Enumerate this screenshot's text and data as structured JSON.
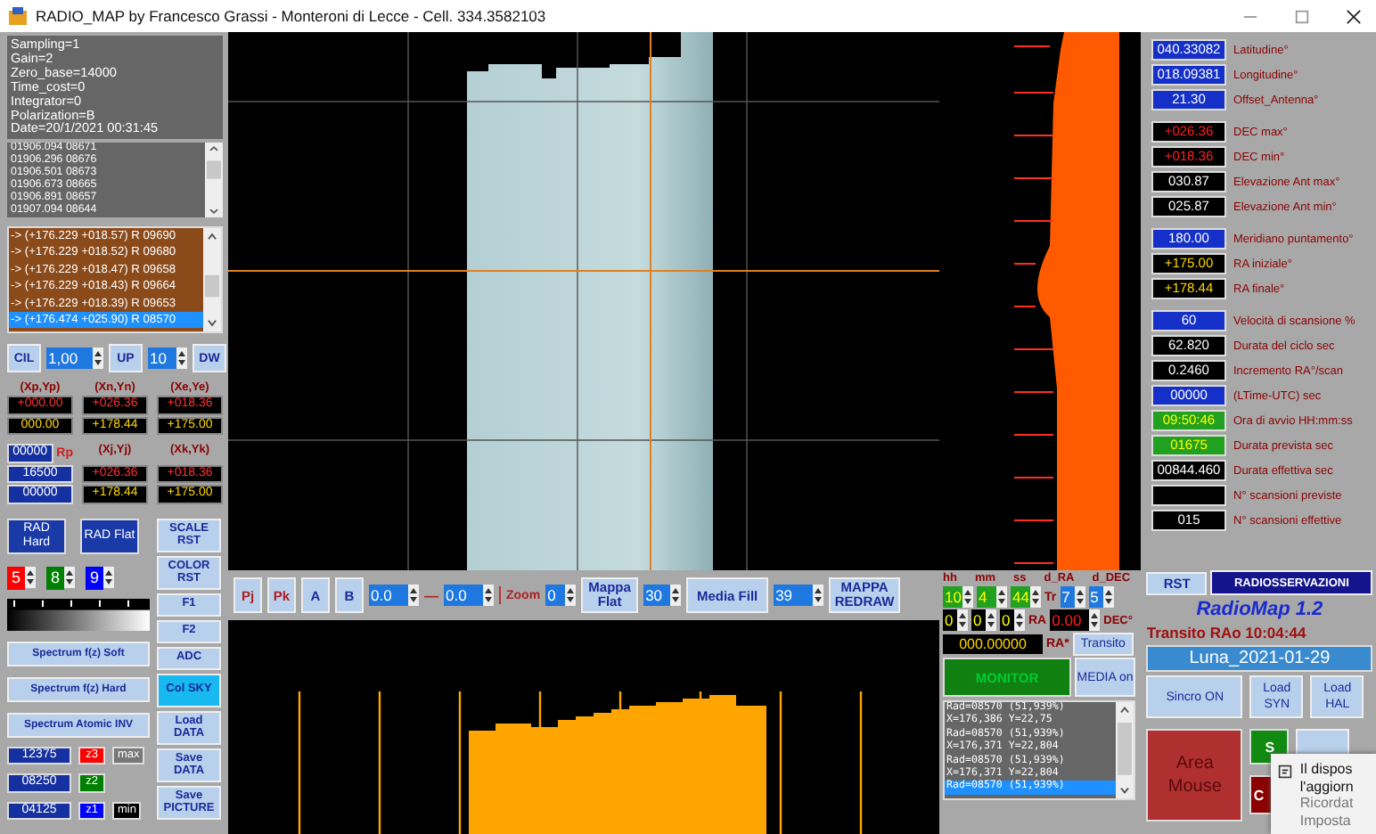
{
  "window": {
    "title": "RADIO_MAP by Francesco Grassi - Monteroni di Lecce - Cell. 334.3582103"
  },
  "info_lines": [
    "Sampling=1",
    "Gain=2",
    "Zero_base=14000",
    "Time_cost=0",
    "Integrator=0",
    "Polarization=B",
    "Date=20/1/2021 00:31:45"
  ],
  "sample_list": [
    "01906.094 08671",
    "01906.296 08676",
    "01906.501 08673",
    "01906.673 08665",
    "01906.891 08657",
    "01907.094 08644"
  ],
  "position_list": [
    {
      "text": "-> (+176.229 +018.57) R 09690",
      "selected": false
    },
    {
      "text": "-> (+176.229 +018.52) R 09680",
      "selected": false
    },
    {
      "text": "-> (+176.229 +018.47) R 09658",
      "selected": false
    },
    {
      "text": "-> (+176.229 +018.43) R 09664",
      "selected": false
    },
    {
      "text": "-> (+176.229 +018.39) R 09653",
      "selected": false
    },
    {
      "text": "-> (+176.474 +025.90) R 08570",
      "selected": true
    }
  ],
  "scan_controls": {
    "cil_button": "CIL",
    "step": "1,00",
    "up_button": "UP",
    "count": "10",
    "dw_button": "DW"
  },
  "coords_top": {
    "labels": [
      "(Xp,Yp)",
      "(Xn,Yn)",
      "(Xe,Ye)"
    ],
    "rows": [
      [
        "+000.00",
        "+026.36",
        "+018.36"
      ],
      [
        "000.00",
        "+178.44",
        "+175.00"
      ]
    ]
  },
  "rp": {
    "value": "00000",
    "label": "Rp"
  },
  "coords_bottom": {
    "labels": [
      "(Xj,Yj)",
      "(Xk,Yk)"
    ],
    "rows": [
      [
        "16500",
        "+026.36",
        "+018.36"
      ],
      [
        "00000",
        "+178.44",
        "+175.00"
      ]
    ]
  },
  "rad_buttons": [
    "RAD Hard",
    "RAD Flat"
  ],
  "color_spinners": [
    {
      "value": "5",
      "color": "#ff0000"
    },
    {
      "value": "8",
      "color": "#008000"
    },
    {
      "value": "9",
      "color": "#0000ff"
    }
  ],
  "spectrum_buttons": [
    "Spectrum f(z) Soft",
    "Spectrum f(z) Hard",
    "Spectrum Atomic INV"
  ],
  "side_buttons": [
    {
      "label": "SCALE RST",
      "selected": false
    },
    {
      "label": "COLOR RST",
      "selected": false
    },
    {
      "label": "F1",
      "selected": false
    },
    {
      "label": "F2",
      "selected": false
    },
    {
      "label": "ADC",
      "selected": false
    },
    {
      "label": "Col SKY",
      "selected": true
    },
    {
      "label": "Load DATA",
      "selected": false
    },
    {
      "label": "Save DATA",
      "selected": false
    },
    {
      "label": "Save PICTURE",
      "selected": false
    }
  ],
  "z_levels": [
    {
      "value": "12375",
      "label": "z3",
      "color": "#ff0000",
      "limit": "max"
    },
    {
      "value": "08250",
      "label": "z2",
      "color": "#008000"
    },
    {
      "value": "04125",
      "label": "z1",
      "color": "#0000ff",
      "limit": "min"
    }
  ],
  "map_toolbar": {
    "buttons": [
      "Pj",
      "Pk",
      "A",
      "B"
    ],
    "range_from": "0.0",
    "range_dash": "—",
    "range_to": "0.0",
    "zoom_label": "Zoom",
    "zoom": "0",
    "flat_button": "Mappa Flat",
    "flat_value": "30",
    "fill_button": "Media Fill",
    "fill_value": "39",
    "redraw_button": "MAPPA REDRAW"
  },
  "field_groups": [
    [
      {
        "value": "040.33082",
        "label": "Latitudine°",
        "kind": "input"
      },
      {
        "value": "018.09381",
        "label": "Longitudine°",
        "kind": "input"
      },
      {
        "value": "21.30",
        "label": "Offset_Antenna°",
        "kind": "input"
      }
    ],
    [
      {
        "value": "+026.36",
        "label": "DEC max°",
        "kind": "limit"
      },
      {
        "value": "+018.36",
        "label": "DEC min°",
        "kind": "limit"
      },
      {
        "value": "030.87",
        "label": "Elevazione Ant max°",
        "kind": "readout"
      },
      {
        "value": "025.87",
        "label": "Elevazione Ant min°",
        "kind": "readout"
      }
    ],
    [
      {
        "value": "180.00",
        "label": "Meridiano puntamento°",
        "kind": "input"
      },
      {
        "value": "+175.00",
        "label": "RA iniziale°",
        "kind": "ra"
      },
      {
        "value": "+178.44",
        "label": "RA finale°",
        "kind": "ra"
      }
    ],
    [
      {
        "value": "60",
        "label": "Velocità di scansione %",
        "kind": "input"
      },
      {
        "value": "62.820",
        "label": "Durata del ciclo sec",
        "kind": "readout"
      },
      {
        "value": "0.2460",
        "label": "Incremento RA°/scan",
        "kind": "readout"
      },
      {
        "value": "00000",
        "label": "(LTime-UTC) sec",
        "kind": "input"
      },
      {
        "value": "09:50:46",
        "label": "Ora di avvio HH:mm:ss",
        "kind": "time"
      },
      {
        "value": "01675",
        "label": "Durata prevista sec",
        "kind": "time"
      },
      {
        "value": "00844.460",
        "label": "Durata effettiva sec",
        "kind": "readout"
      },
      {
        "label": "N° scansioni previste",
        "kind": "readout"
      },
      {
        "value": "015",
        "label": "N° scansioni effettive",
        "kind": "readout"
      }
    ]
  ],
  "time_panel": {
    "time_labels": [
      "hh",
      "mm",
      "ss"
    ],
    "time_values": [
      "10",
      "4",
      "44"
    ],
    "tr_label": "Tr",
    "offset_labels": [
      "d_RA",
      "d_DEC"
    ],
    "offset_values": [
      "7",
      "5"
    ],
    "ra_values": [
      "0",
      "0",
      "0"
    ],
    "ra_label": "RA",
    "dec_value": "0.00",
    "dec_label": "DEC°",
    "ra_readout": "000.00000",
    "ra_readout_label": "RA*",
    "transit_button": "Transito",
    "monitor_button": "MONITOR",
    "media_button": "MEDIA on"
  },
  "log_list": [
    {
      "text": "Rad=08570 (51,939%)",
      "selected": false
    },
    {
      "text": "X=176,386 Y=22,75",
      "selected": false
    },
    {
      "text": "Rad=08570 (51,939%)",
      "selected": false
    },
    {
      "text": "X=176,371 Y=22,804",
      "selected": false
    },
    {
      "text": "Rad=08570 (51,939%)",
      "selected": false
    },
    {
      "text": "X=176,371 Y=22,804",
      "selected": false
    },
    {
      "text": "Rad=08570 (51,939%)",
      "selected": true
    }
  ],
  "control_panel": {
    "rst_button": "RST",
    "observations_button": "RADIOSSERVAZIONI",
    "app_title": "RadioMap 1.2",
    "transit_time": "Transito RAo 10:04:44",
    "session_name": "Luna_2021-01-29",
    "sync_button": "Sincro ON",
    "load_syn_button": "Load SYN",
    "load_hal_button": "Load HAL",
    "area_mouse_button": "Area Mouse",
    "s_button": "S",
    "c_button": "C"
  },
  "notification": {
    "lines": [
      "Il dispos",
      "l'aggiorn",
      "Ricordat",
      "Imposta"
    ]
  }
}
